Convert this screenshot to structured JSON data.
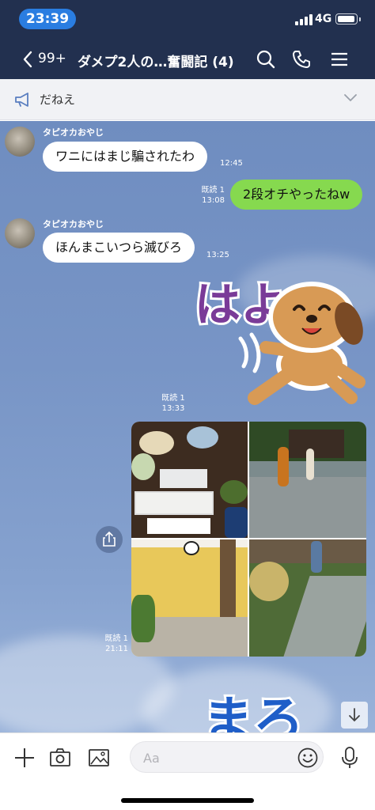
{
  "status_bar": {
    "time": "23:39",
    "network": "4G"
  },
  "header": {
    "back_count": "99+",
    "title": "ダメプ2人の…奮闘記 (4)",
    "icons": [
      "back-chevron-icon",
      "search-icon",
      "phone-icon",
      "menu-icon"
    ]
  },
  "announcement": {
    "text": "だねえ",
    "icon": "megaphone-icon"
  },
  "messages": [
    {
      "type": "incoming",
      "sender": "タピオカおやじ",
      "text": "ワニにはまじ騙されたわ",
      "time": "12:45"
    },
    {
      "type": "outgoing",
      "read": "既読 1",
      "time": "13:08",
      "text": "2段オチやったねw"
    },
    {
      "type": "incoming",
      "sender": "タピオカおやじ",
      "text": "ほんまこいつら滅びろ",
      "time": "13:25"
    },
    {
      "type": "outgoing_sticker",
      "read": "既読 1",
      "time": "13:33",
      "sticker_text": "はよ"
    },
    {
      "type": "outgoing_photos",
      "read": "既読 1",
      "time": "21:11",
      "photo_count": 4
    },
    {
      "type": "outgoing_sticker_partial",
      "sticker_text": "まろ"
    }
  ],
  "input_bar": {
    "placeholder": "Aa",
    "icons": [
      "plus-icon",
      "camera-icon",
      "image-icon",
      "emoji-icon",
      "microphone-icon"
    ]
  },
  "colors": {
    "header_bg": "#22304f",
    "time_pill": "#2a7de1",
    "outgoing_bubble": "#86d94f",
    "incoming_bubble": "#ffffff",
    "chat_bg": "#7895c6"
  }
}
